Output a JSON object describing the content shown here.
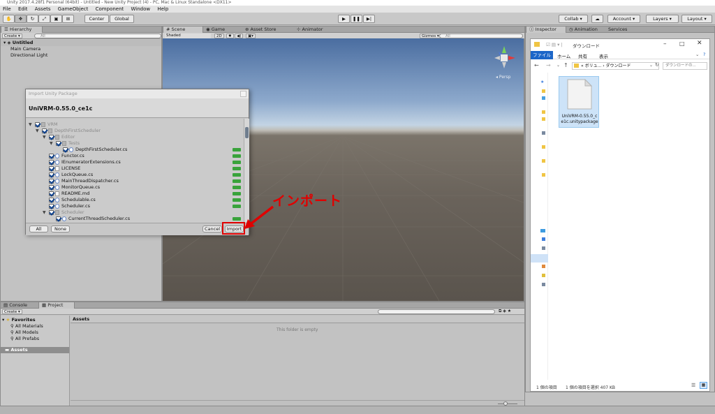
{
  "title": "Unity 2017.4.28f1 Personal (64bit) - Untitled - New Unity Project (4) - PC, Mac & Linux Standalone <DX11>",
  "menu": [
    "File",
    "Edit",
    "Assets",
    "GameObject",
    "Component",
    "Window",
    "Help"
  ],
  "toolbar": {
    "center": "Center",
    "global": "Global",
    "collab": "Collab ▾",
    "account": "Account",
    "layers": "Layers",
    "layout": "Layout"
  },
  "hierarchy": {
    "tab": "Hierarchy",
    "create": "Create ▾",
    "search_placeholder": "All",
    "scene": "Untitled",
    "items": [
      "Main Camera",
      "Directional Light"
    ]
  },
  "scene_view": {
    "tabs": [
      "Scene",
      "Game",
      "Asset Store",
      "Animator"
    ],
    "shading": "Shaded",
    "mode2d": "2D",
    "gizmos": "Gizmos ▾",
    "search_placeholder": "All",
    "persp": "Persp"
  },
  "inspector": {
    "tabs": [
      "Inspector",
      "Animation",
      "Services"
    ]
  },
  "dialog": {
    "title": "Import Unity Package",
    "package": "UniVRM-0.55.0_ce1c",
    "rows": [
      {
        "label": "VRM",
        "indent": 0,
        "checked": true,
        "type": "folder",
        "tri": true,
        "dim": true,
        "isnew": false
      },
      {
        "label": "DepthFirstScheduler",
        "indent": 1,
        "checked": true,
        "type": "folder",
        "tri": true,
        "dim": true,
        "isnew": false
      },
      {
        "label": "Editor",
        "indent": 2,
        "checked": true,
        "type": "folder",
        "tri": true,
        "dim": true,
        "isnew": false
      },
      {
        "label": "Tests",
        "indent": 3,
        "checked": true,
        "type": "folder",
        "tri": true,
        "dim": true,
        "isnew": false
      },
      {
        "label": "DepthFirstScheduler.cs",
        "indent": 4,
        "checked": true,
        "type": "cs",
        "tri": false,
        "dim": false,
        "isnew": true
      },
      {
        "label": "Functor.cs",
        "indent": 2,
        "checked": true,
        "type": "cs",
        "tri": false,
        "dim": false,
        "isnew": true
      },
      {
        "label": "IEnumeratorExtensions.cs",
        "indent": 2,
        "checked": true,
        "type": "cs",
        "tri": false,
        "dim": false,
        "isnew": true
      },
      {
        "label": "LICENSE",
        "indent": 2,
        "checked": true,
        "type": "file",
        "tri": false,
        "dim": false,
        "isnew": true
      },
      {
        "label": "LockQueue.cs",
        "indent": 2,
        "checked": true,
        "type": "cs",
        "tri": false,
        "dim": false,
        "isnew": true
      },
      {
        "label": "MainThreadDispatcher.cs",
        "indent": 2,
        "checked": true,
        "type": "cs",
        "tri": false,
        "dim": false,
        "isnew": true
      },
      {
        "label": "MonitorQueue.cs",
        "indent": 2,
        "checked": true,
        "type": "cs",
        "tri": false,
        "dim": false,
        "isnew": true
      },
      {
        "label": "README.md",
        "indent": 2,
        "checked": true,
        "type": "file",
        "tri": false,
        "dim": false,
        "isnew": true
      },
      {
        "label": "Schedulable.cs",
        "indent": 2,
        "checked": true,
        "type": "cs",
        "tri": false,
        "dim": false,
        "isnew": true
      },
      {
        "label": "Scheduler.cs",
        "indent": 2,
        "checked": true,
        "type": "cs",
        "tri": false,
        "dim": false,
        "isnew": true
      },
      {
        "label": "Scheduler",
        "indent": 2,
        "checked": true,
        "type": "folder",
        "tri": true,
        "dim": true,
        "isnew": false
      },
      {
        "label": "CurrentThreadScheduler.cs",
        "indent": 3,
        "checked": true,
        "type": "cs",
        "tri": false,
        "dim": false,
        "isnew": true
      }
    ],
    "all": "All",
    "none": "None",
    "cancel": "Cancel",
    "import": "Import"
  },
  "annotation": "インポート",
  "explorer": {
    "title": "ダウンロード",
    "ribbon_tabs": [
      "ファイル",
      "ホーム",
      "共有",
      "表示"
    ],
    "path": "« ボリュ... › ダウンロード",
    "search_placeholder": "ダウンロードの...",
    "file_name": "UniVRM-0.55.0_c e1c.unitypackage",
    "status_count": "1 個の項目",
    "status_selected": "1 個の項目を選択  407 KB"
  },
  "bottom": {
    "tabs": [
      "Console",
      "Project"
    ],
    "create": "Create ▾",
    "favorites": "Favorites",
    "fav_items": [
      "All Materials",
      "All Models",
      "All Prefabs"
    ],
    "assets_root": "Assets",
    "assets_header": "Assets",
    "empty": "This folder is empty"
  }
}
